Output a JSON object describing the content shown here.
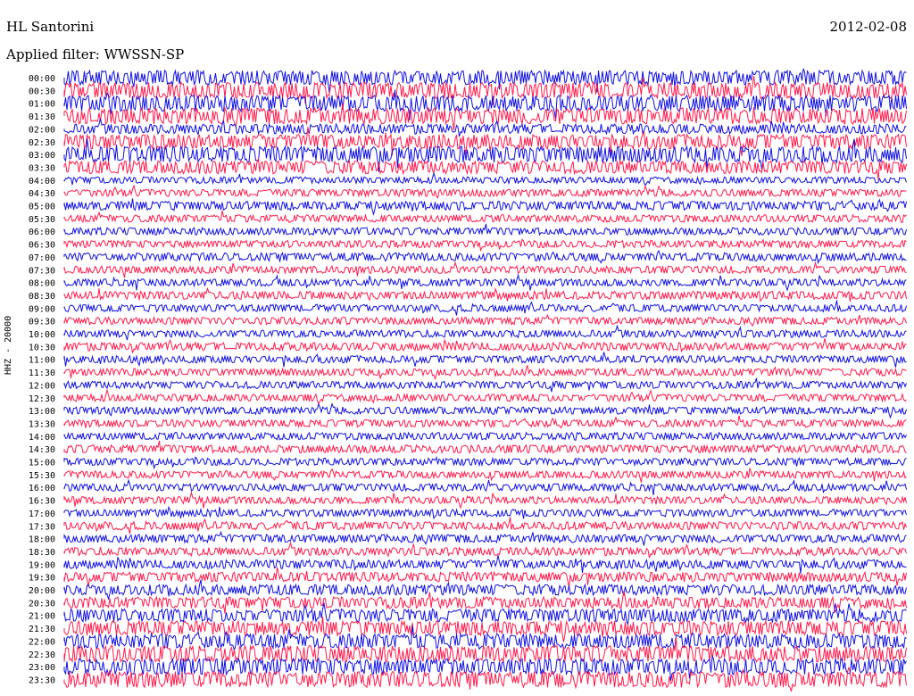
{
  "header": {
    "station": "HL Santorini",
    "date": "2012-02-08",
    "filter": "Applied filter: WWSSN-SP"
  },
  "channel_label": "HHZ - 20000",
  "colors": {
    "odd": "#1010e0",
    "even": "#ff1a4b",
    "background": "#ffffff"
  },
  "chart_data": {
    "type": "line",
    "title": "HL Santorini",
    "subtitle": "Applied filter: WWSSN-SP",
    "ylabel": "HHZ - 20000",
    "xlabel": "",
    "grid": false,
    "rows": [
      {
        "label": "00:00",
        "amp": 0.9
      },
      {
        "label": "00:30",
        "amp": 1.0
      },
      {
        "label": "01:00",
        "amp": 1.0
      },
      {
        "label": "01:30",
        "amp": 1.0
      },
      {
        "label": "02:00",
        "amp": 0.6
      },
      {
        "label": "02:30",
        "amp": 0.9
      },
      {
        "label": "03:00",
        "amp": 1.0
      },
      {
        "label": "03:30",
        "amp": 0.8
      },
      {
        "label": "04:00",
        "amp": 0.4
      },
      {
        "label": "04:30",
        "amp": 0.45
      },
      {
        "label": "05:00",
        "amp": 0.55
      },
      {
        "label": "05:30",
        "amp": 0.45
      },
      {
        "label": "06:00",
        "amp": 0.45
      },
      {
        "label": "06:30",
        "amp": 0.45
      },
      {
        "label": "07:00",
        "amp": 0.5
      },
      {
        "label": "07:30",
        "amp": 0.45
      },
      {
        "label": "08:00",
        "amp": 0.45
      },
      {
        "label": "08:30",
        "amp": 0.5
      },
      {
        "label": "09:00",
        "amp": 0.45
      },
      {
        "label": "09:30",
        "amp": 0.45
      },
      {
        "label": "10:00",
        "amp": 0.45
      },
      {
        "label": "10:30",
        "amp": 0.5
      },
      {
        "label": "11:00",
        "amp": 0.45
      },
      {
        "label": "11:30",
        "amp": 0.45
      },
      {
        "label": "12:00",
        "amp": 0.45
      },
      {
        "label": "12:30",
        "amp": 0.45
      },
      {
        "label": "13:00",
        "amp": 0.45
      },
      {
        "label": "13:30",
        "amp": 0.45
      },
      {
        "label": "14:00",
        "amp": 0.45
      },
      {
        "label": "14:30",
        "amp": 0.5
      },
      {
        "label": "15:00",
        "amp": 0.45
      },
      {
        "label": "15:30",
        "amp": 0.45
      },
      {
        "label": "16:00",
        "amp": 0.45
      },
      {
        "label": "16:30",
        "amp": 0.45
      },
      {
        "label": "17:00",
        "amp": 0.45
      },
      {
        "label": "17:30",
        "amp": 0.5
      },
      {
        "label": "18:00",
        "amp": 0.5
      },
      {
        "label": "18:30",
        "amp": 0.5
      },
      {
        "label": "19:00",
        "amp": 0.55
      },
      {
        "label": "19:30",
        "amp": 0.6
      },
      {
        "label": "20:00",
        "amp": 0.65
      },
      {
        "label": "20:30",
        "amp": 0.7
      },
      {
        "label": "21:00",
        "amp": 0.8
      },
      {
        "label": "21:30",
        "amp": 0.9
      },
      {
        "label": "22:00",
        "amp": 0.9
      },
      {
        "label": "22:30",
        "amp": 1.0
      },
      {
        "label": "23:00",
        "amp": 1.0
      },
      {
        "label": "23:30",
        "amp": 1.0
      }
    ]
  }
}
